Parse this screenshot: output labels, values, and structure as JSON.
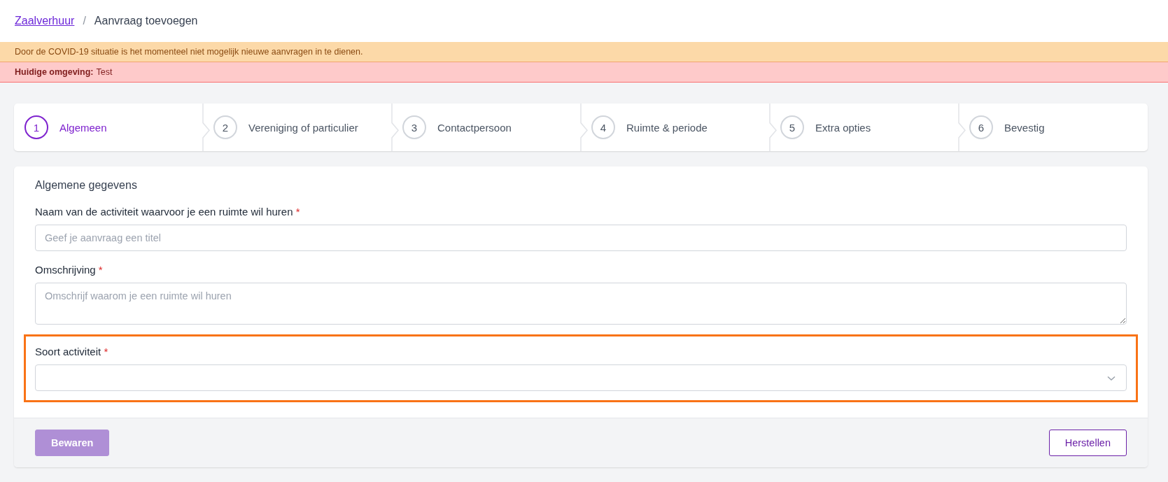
{
  "breadcrumb": [
    {
      "label": "Zaalverhuur",
      "kind": "link"
    },
    {
      "label": "/",
      "kind": "separator"
    },
    {
      "label": "Aanvraag toevoegen",
      "kind": "current"
    }
  ],
  "notices": [
    {
      "kind": "warning",
      "text": "Door de COVID-19 situatie is het momenteel niet mogelijk nieuwe aanvragen in te dienen."
    },
    {
      "kind": "danger",
      "label": "Huidige omgeving:",
      "text": "Test"
    }
  ],
  "steps": [
    {
      "number": "1",
      "label": "Algemeen",
      "selected": true
    },
    {
      "number": "2",
      "label": "Vereniging of particulier",
      "selected": false
    },
    {
      "number": "3",
      "label": "Contactpersoon",
      "selected": false
    },
    {
      "number": "4",
      "label": "Ruimte & periode",
      "selected": false
    },
    {
      "number": "5",
      "label": "Extra opties",
      "selected": false
    },
    {
      "number": "6",
      "label": "Bevestig",
      "selected": false
    }
  ],
  "form": {
    "title": "Algemene gegevens",
    "fields": [
      {
        "kind": "text",
        "label": "Naam van de activiteit waarvoor je een ruimte wil huren",
        "required_mark": "*",
        "placeholder": "Geef je aanvraag een titel"
      },
      {
        "kind": "textarea",
        "label": "Omschrijving",
        "required_mark": "*",
        "placeholder": "Omschrijf waarom je een ruimte wil huren"
      },
      {
        "kind": "select",
        "label": "Soort activiteit",
        "required_mark": "*",
        "highlighted": true
      }
    ],
    "buttons": [
      {
        "label": "Bewaren",
        "kind": "primary",
        "disabled": true
      },
      {
        "label": "Herstellen",
        "kind": "outline",
        "disabled": false
      }
    ]
  }
}
